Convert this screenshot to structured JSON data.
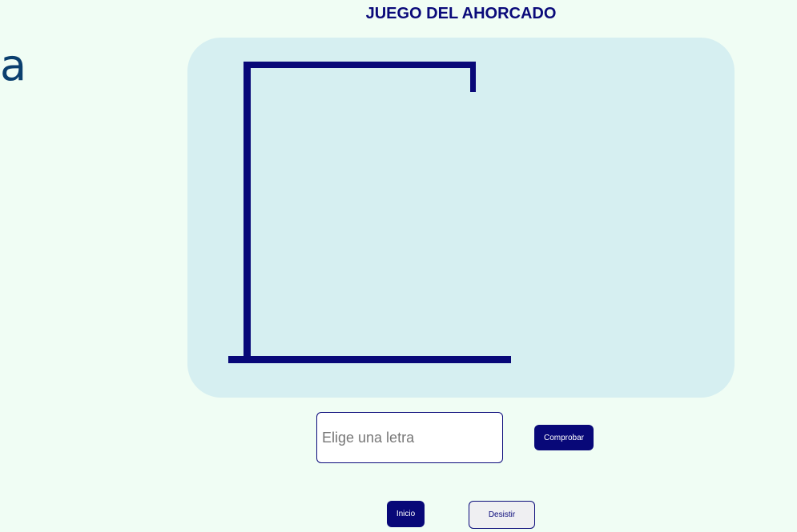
{
  "logo": {
    "text": "a"
  },
  "title": "JUEGO DEL AHORCADO",
  "board": {
    "gallows_color": "#080878",
    "background_color": "#d6eff1"
  },
  "guess": {
    "placeholder": "Elige una letra",
    "value": ""
  },
  "buttons": {
    "check_label": "Comprobar",
    "start_label": "Inicio",
    "quit_label": "Desistir"
  },
  "colors": {
    "primary": "#080878",
    "page_background": "#f0fdf4"
  }
}
